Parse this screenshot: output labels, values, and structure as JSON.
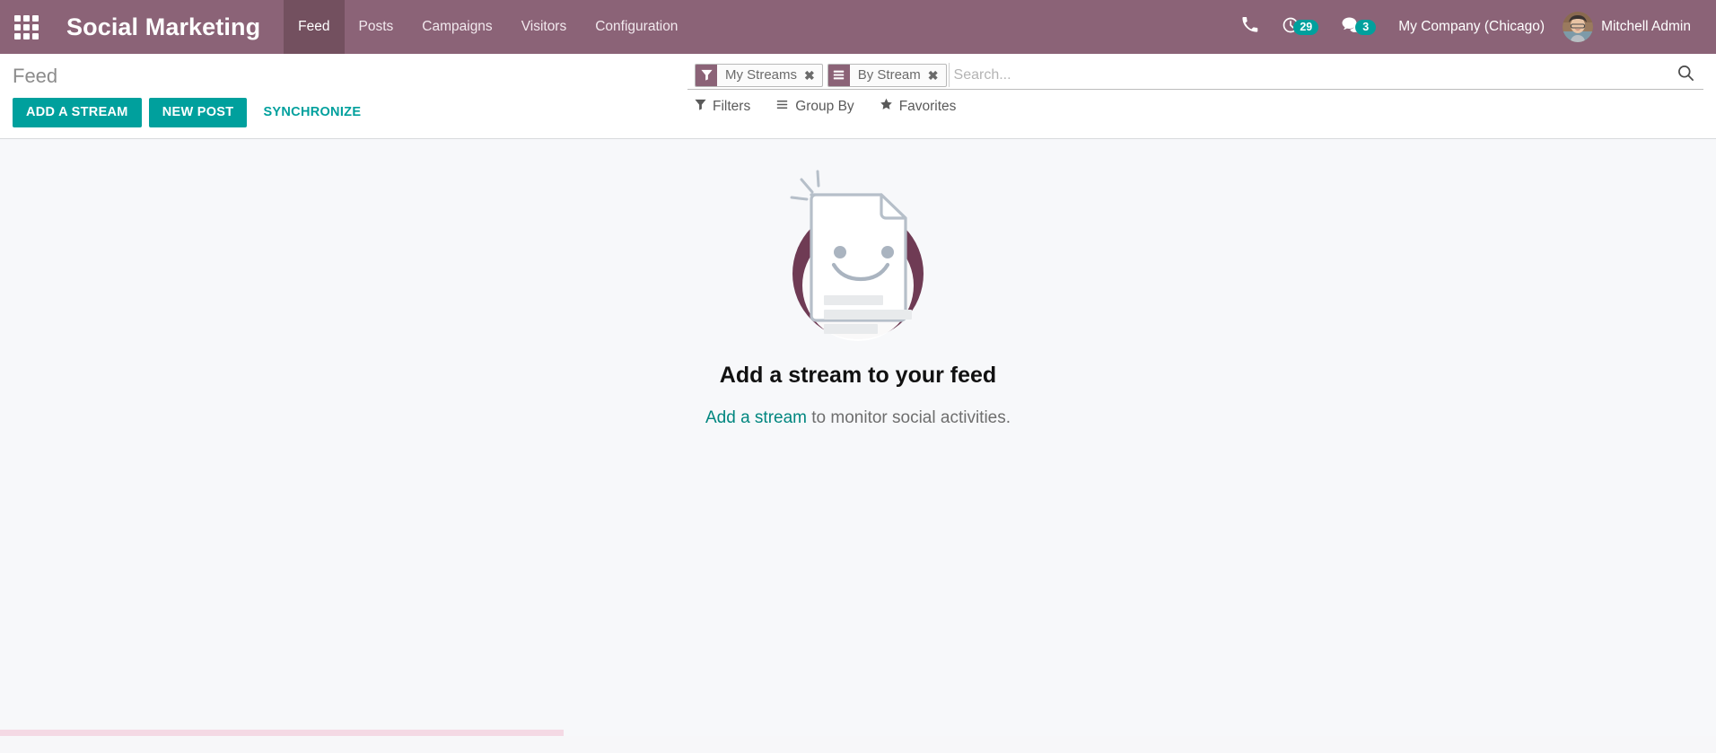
{
  "navbar": {
    "apps_icon": "apps-grid-icon",
    "brand": "Social Marketing",
    "menu": [
      {
        "label": "Feed",
        "active": true
      },
      {
        "label": "Posts",
        "active": false
      },
      {
        "label": "Campaigns",
        "active": false
      },
      {
        "label": "Visitors",
        "active": false
      },
      {
        "label": "Configuration",
        "active": false
      }
    ],
    "systray": {
      "phone_icon": "phone-icon",
      "activities_icon": "clock-icon",
      "activities_count": "29",
      "messages_icon": "chat-bubble-icon",
      "messages_count": "3",
      "company": "My Company (Chicago)",
      "user_name": "Mitchell Admin",
      "avatar_icon": "user-avatar"
    },
    "colors": {
      "background": "#8b6377",
      "active_item": "#73505f",
      "badge": "#00A09D"
    }
  },
  "control_panel": {
    "breadcrumb": "Feed",
    "buttons": {
      "add_a_stream": "ADD A STREAM",
      "new_post": "NEW POST",
      "synchronize": "SYNCHRONIZE"
    },
    "search": {
      "placeholder": "Search...",
      "value": "",
      "search_icon": "magnifier-icon",
      "facets": [
        {
          "label": "My Streams",
          "icon": "filter-funnel-icon",
          "remove_icon": "close-x-icon"
        },
        {
          "label": "By Stream",
          "icon": "group-by-bars-icon",
          "remove_icon": "close-x-icon"
        }
      ]
    },
    "filter_menus": [
      {
        "label": "Filters",
        "icon": "filter-funnel-icon"
      },
      {
        "label": "Group By",
        "icon": "group-by-bars-icon"
      },
      {
        "label": "Favorites",
        "icon": "star-icon"
      }
    ],
    "colors": {
      "primary_button": "#00A09D",
      "link": "#00A09D"
    }
  },
  "content": {
    "empty_state": {
      "illustration_icon": "smiling-document-icon",
      "title": "Add a stream to your feed",
      "link_text": "Add a stream",
      "subtitle_rest": " to monitor social activities."
    },
    "colors": {
      "background": "#f7f8fa",
      "illustration_circle": "#6f3b54",
      "progress_strip": "#f4d9e4"
    }
  }
}
